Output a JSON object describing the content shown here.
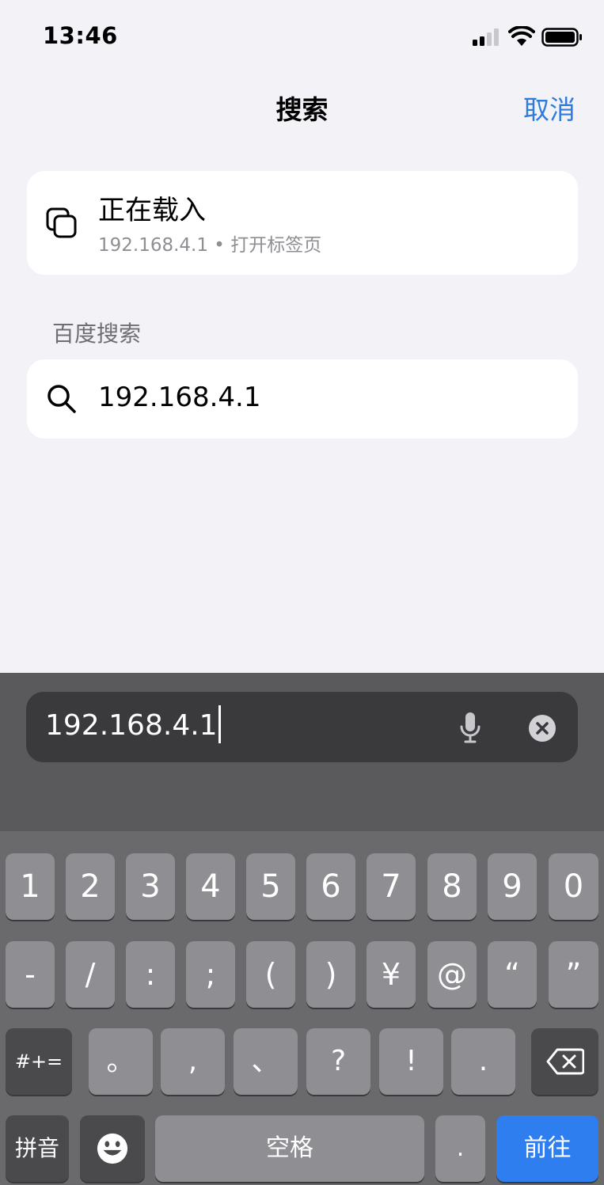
{
  "status": {
    "time": "13:46"
  },
  "nav": {
    "title": "搜索",
    "cancel": "取消"
  },
  "tab_result": {
    "title": "正在载入",
    "subtitle": "192.168.4.1 • 打开标签页"
  },
  "section_header": "百度搜索",
  "search_suggestion": "192.168.4.1",
  "address_bar": {
    "value": "192.168.4.1"
  },
  "keyboard": {
    "row1": [
      "1",
      "2",
      "3",
      "4",
      "5",
      "6",
      "7",
      "8",
      "9",
      "0"
    ],
    "row2": [
      "-",
      "/",
      ":",
      ";",
      "(",
      ")",
      "¥",
      "@",
      "“",
      "”"
    ],
    "row3": {
      "shift": "#+=",
      "keys": [
        "。",
        ",",
        "、",
        "?",
        "!",
        "."
      ]
    },
    "row4": {
      "mode": "拼音",
      "space": "空格",
      "dot": ".",
      "go": "前往"
    }
  },
  "colors": {
    "accent": "#2f7bdb",
    "go_key": "#2f7ef0"
  }
}
